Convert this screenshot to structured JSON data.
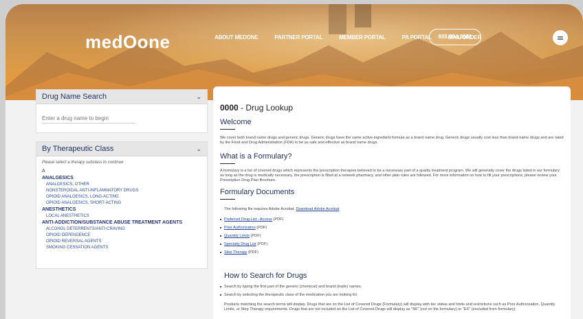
{
  "brand": {
    "logo_text": "medOone"
  },
  "nav": {
    "items": [
      "ABOUT MEDONE",
      "PARTNER PORTAL",
      "MEMBER PORTAL",
      "PA PORTAL",
      "MAIL ORDER"
    ],
    "phone": "888.894.8981"
  },
  "drug_search": {
    "title": "Drug Name Search",
    "placeholder": "Enter a drug name to begin"
  },
  "therapeutic": {
    "title": "By Therapeutic Class",
    "note": "Please select a therapy subclass to continue",
    "letter": "A",
    "groups": [
      {
        "name": "ANALGESICS",
        "items": [
          "ANALGESICS, OTHER",
          "NONSTEROIDAL ANTI-INFLAMMATORY DRUGS",
          "OPIOID ANALGESICS, LONG-ACTING",
          "OPIOID ANALGESICS, SHORT-ACTING"
        ]
      },
      {
        "name": "ANESTHETICS",
        "items": [
          "LOCAL ANESTHETICS"
        ]
      },
      {
        "name": "ANTI-ADDICTION/SUBSTANCE ABUSE TREATMENT AGENTS",
        "items": [
          "ALCOHOL DETERRENTS/ANTI-CRAVING",
          "OPIOID DEPENDENCE",
          "OPIOID REVERSAL AGENTS",
          "SMOKING CESSATION AGENTS"
        ]
      }
    ]
  },
  "main": {
    "drug_code": "0000",
    "drug_title": " - Drug Lookup",
    "welcome_title": "Welcome",
    "welcome_text": "We cover both brand name drugs and generic drugs. Generic drugs have the same active-ingredient formula as a brand name drug. Generic drugs usually cost less than brand name drugs and are rated by the Food and Drug Administration (FDA) to be as safe and effective as brand name drugs.",
    "formulary_title": "What is a Formulary?",
    "formulary_text": "A formulary is a list of covered drugs which represents the prescription therapies believed to be a necessary part of a quality treatment program. We will generally cover the drugs listed in our formulary as long as the drug is medically necessary, the prescription is filled at a network pharmacy, and other plan rules are followed. For more information on how to fill your prescriptions, please review your Prescription Drug Plan Brochure.",
    "docs_title": "Formulary Documents",
    "acrobat_text": "The following file requires Adobe Acrobat.",
    "acrobat_link": "Download Adobe Acrobat",
    "docs": [
      {
        "label": "Preferred Drug List - Access",
        "suffix": " (PDF)"
      },
      {
        "label": "Prior Authorization",
        "suffix": " (PDF)"
      },
      {
        "label": "Quantity Limits",
        "suffix": " (PDF)"
      },
      {
        "label": "Specialty Drug List",
        "suffix": " (PDF)"
      },
      {
        "label": "Step Therapy",
        "suffix": " (PDF)"
      }
    ],
    "howto_title": "How to Search for Drugs",
    "howto_items": [
      "Search by typing the first part of the generic (chemical) and brand (trade) names.",
      "Search by selecting the therapeutic class of the medication you are looking for."
    ],
    "howto_text": "Products matching the search terms will display. Drugs that are on the List of Covered Drugs (Formulary) will display with tier status and limits and restrictions such as Prior Authorization, Quantity Limits, or Step Therapy requirements. Drugs that are not included on the List of Covered Drugs will display as \"NF\" (not on the formulary) or \"EX\" (excluded from formulary)."
  }
}
